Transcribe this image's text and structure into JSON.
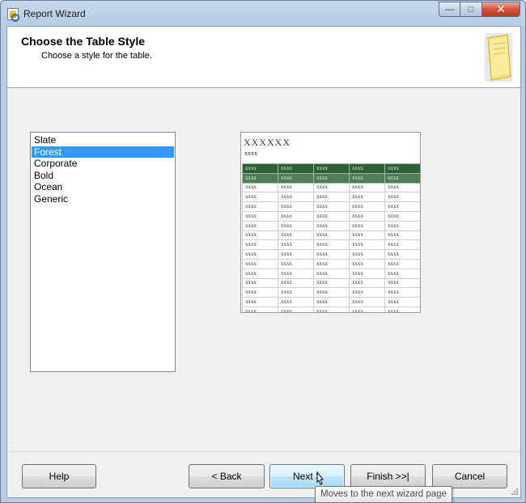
{
  "window": {
    "title": "Report Wizard",
    "minimize_glyph": "—",
    "maximize_glyph": "□",
    "close_glyph": "✕"
  },
  "header": {
    "title": "Choose the Table Style",
    "subtitle": "Choose a style for the table."
  },
  "styles": {
    "items": [
      "Slate",
      "Forest",
      "Corporate",
      "Bold",
      "Ocean",
      "Generic"
    ],
    "selected": "Forest"
  },
  "preview": {
    "title": "XXXXXX",
    "subtitle": "xxxx",
    "cell_text": "xxxx",
    "header_color": "#2f5f36",
    "header_alt_color": "#4f7f56"
  },
  "buttons": {
    "help": "Help",
    "back": "< Back",
    "next": "Next >",
    "finish": "Finish >>|",
    "cancel": "Cancel"
  },
  "tooltip": {
    "text": "Moves to the next wizard page"
  },
  "icons": {
    "app": "report-wizard-icon",
    "header": "report-page-icon",
    "cursor": "mouse-pointer-icon"
  }
}
